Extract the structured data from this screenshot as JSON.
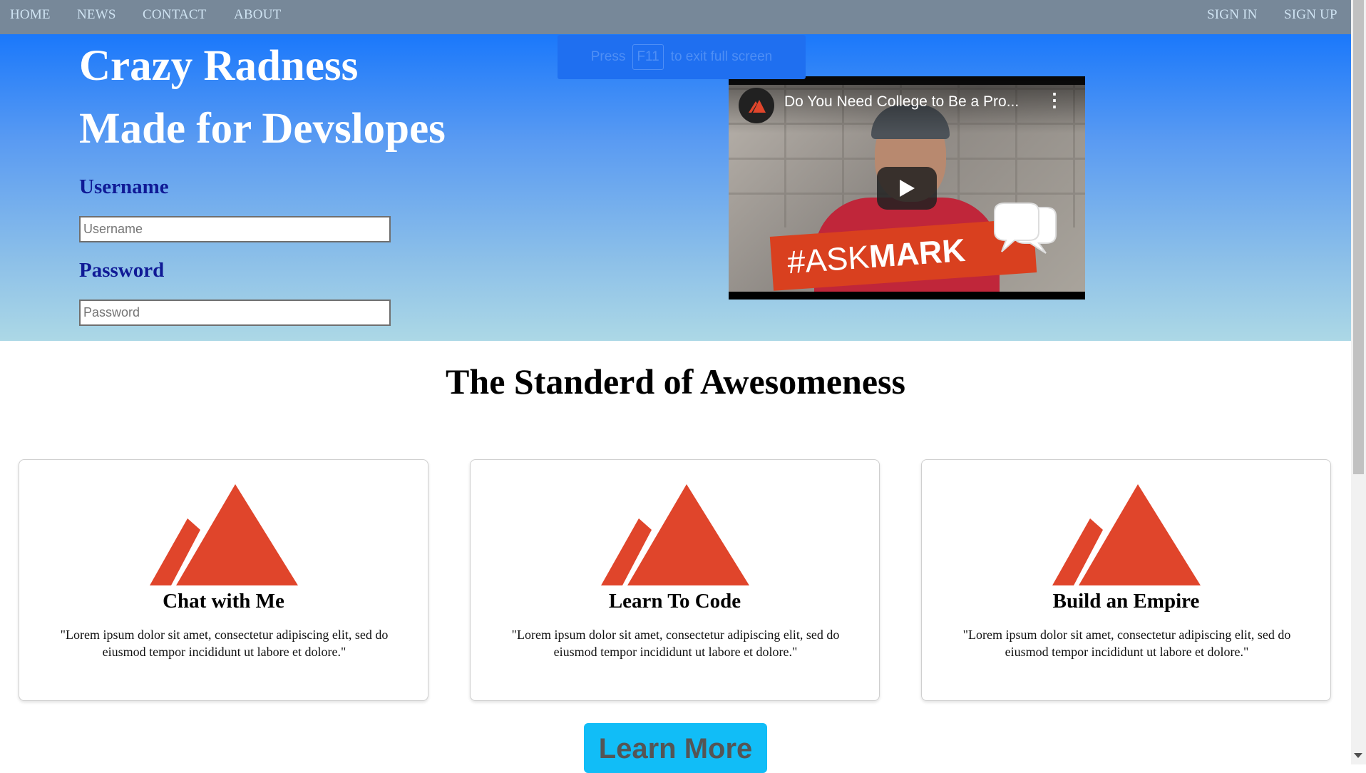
{
  "nav": {
    "left": [
      {
        "label": "HOME"
      },
      {
        "label": "NEWS"
      },
      {
        "label": "CONTACT"
      },
      {
        "label": "ABOUT"
      }
    ],
    "right": [
      {
        "label": "SIGN IN"
      },
      {
        "label": "SIGN UP"
      }
    ]
  },
  "hero": {
    "title_line1": "Crazy Radness",
    "title_line2": "Made for Devslopes",
    "username_label": "Username",
    "username_placeholder": "Username",
    "password_label": "Password",
    "password_placeholder": "Password"
  },
  "fullscreen_notice": {
    "prefix": "Press",
    "key": "F11",
    "suffix": "to exit full screen"
  },
  "video": {
    "title": "Do You Need College to Be a Pro...",
    "banner_prefix": "#ASK",
    "banner_bold": "MARK",
    "menu_icon": "more-vertical-icon",
    "play_icon": "play-icon"
  },
  "features": {
    "title": "The Standerd of Awesomeness",
    "cards": [
      {
        "title": "Chat with Me",
        "text": "\"Lorem ipsum dolor sit amet, consectetur adipiscing elit, sed do eiusmod tempor incididunt ut labore et dolore.\""
      },
      {
        "title": "Learn To Code",
        "text": "\"Lorem ipsum dolor sit amet, consectetur adipiscing elit, sed do eiusmod tempor incididunt ut labore et dolore.\""
      },
      {
        "title": "Build an Empire",
        "text": "\"Lorem ipsum dolor sit amet, consectetur adipiscing elit, sed do eiusmod tempor incididunt ut labore et dolore.\""
      }
    ],
    "logo_icon": "devslopes-logo-icon",
    "logo_color": "#e0452b"
  },
  "cta": {
    "label": "Learn More"
  },
  "colors": {
    "nav_bg": "#778899",
    "nav_text": "#cfe3f2",
    "hero_top": "#1a78fb",
    "hero_bottom": "#acd8e6",
    "label_color": "#101a96",
    "cta_bg": "#11bdf7"
  }
}
